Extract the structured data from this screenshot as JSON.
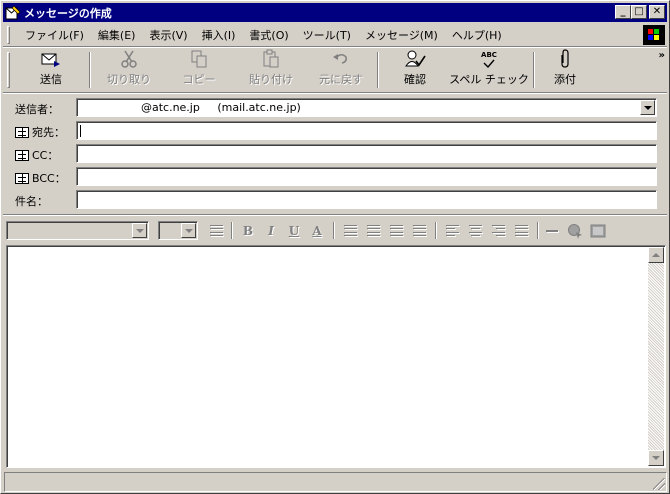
{
  "window": {
    "title": "メッセージの作成",
    "minimize_glyph": "_",
    "maximize_glyph": "□",
    "close_glyph": "✕"
  },
  "menu": {
    "items": [
      "ファイル(F)",
      "編集(E)",
      "表示(V)",
      "挿入(I)",
      "書式(O)",
      "ツール(T)",
      "メッセージ(M)",
      "ヘルプ(H)"
    ]
  },
  "toolbar": {
    "send": "送信",
    "cut": "切り取り",
    "copy": "コピー",
    "paste": "貼り付け",
    "undo": "元に戻す",
    "check": "確認",
    "spelling": "スペル チェック",
    "spelling_icon_text": "ABC",
    "attach": "添付",
    "more": "»"
  },
  "header": {
    "from_label": "送信者：",
    "from_value": "        @atc.ne.jp     (mail.atc.ne.jp)",
    "to_label": "宛先：",
    "to_value": "",
    "cc_label": "CC：",
    "cc_value": "",
    "bcc_label": "BCC：",
    "bcc_value": "",
    "subject_label": "件名：",
    "subject_value": ""
  },
  "format_bar": {
    "font": "",
    "size": "",
    "bold": "B",
    "italic": "I",
    "underline": "U",
    "font_color": "A"
  },
  "colors": {
    "title_bar": "#000080",
    "face": "#d4d0c8",
    "disabled_text": "#808080"
  }
}
